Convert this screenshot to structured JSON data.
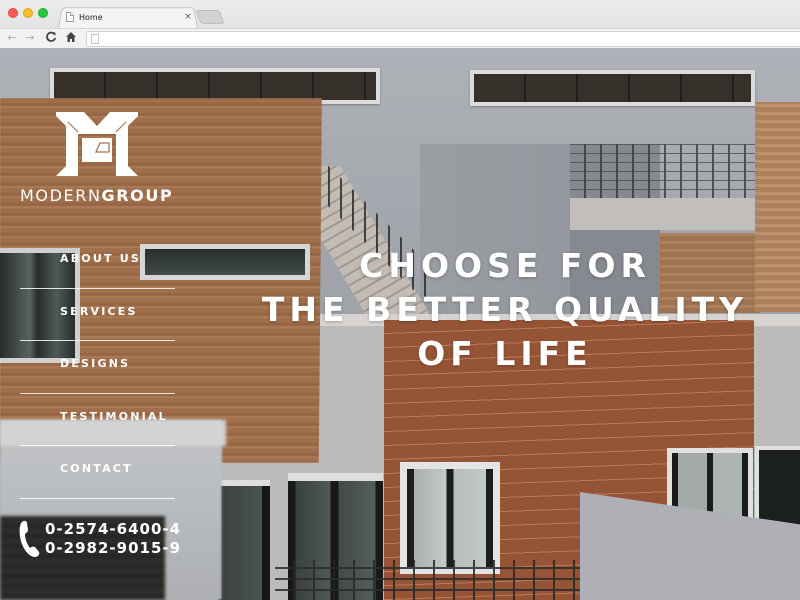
{
  "browser": {
    "tab_title": "Home",
    "tab_close_glyph": "×",
    "url_value": "",
    "url_placeholder": "",
    "icons": {
      "back": "←",
      "forward": "→",
      "reload": "C",
      "home": "⌂"
    }
  },
  "brand": {
    "name_light": "MODERN",
    "name_bold": "GROUP",
    "logo_icon": "mg-monogram-icon"
  },
  "menu": {
    "items": [
      {
        "label": "ABOUT US"
      },
      {
        "label": "SERVICES"
      },
      {
        "label": "DESIGNS"
      },
      {
        "label": "TESTIMONIAL"
      },
      {
        "label": "CONTACT"
      }
    ]
  },
  "contact": {
    "icon": "phone-icon",
    "phones": [
      "0-2574-6400-4",
      "0-2982-9015-9"
    ]
  },
  "hero": {
    "headline_lines": [
      "CHOOSE FOR",
      "THE BETTER QUALITY",
      "OF LIFE"
    ]
  },
  "colors": {
    "text": "#ffffff",
    "brick": "#a97550",
    "accent_wall": "#a05a3a",
    "sky_wall": "#b9bdc3"
  }
}
